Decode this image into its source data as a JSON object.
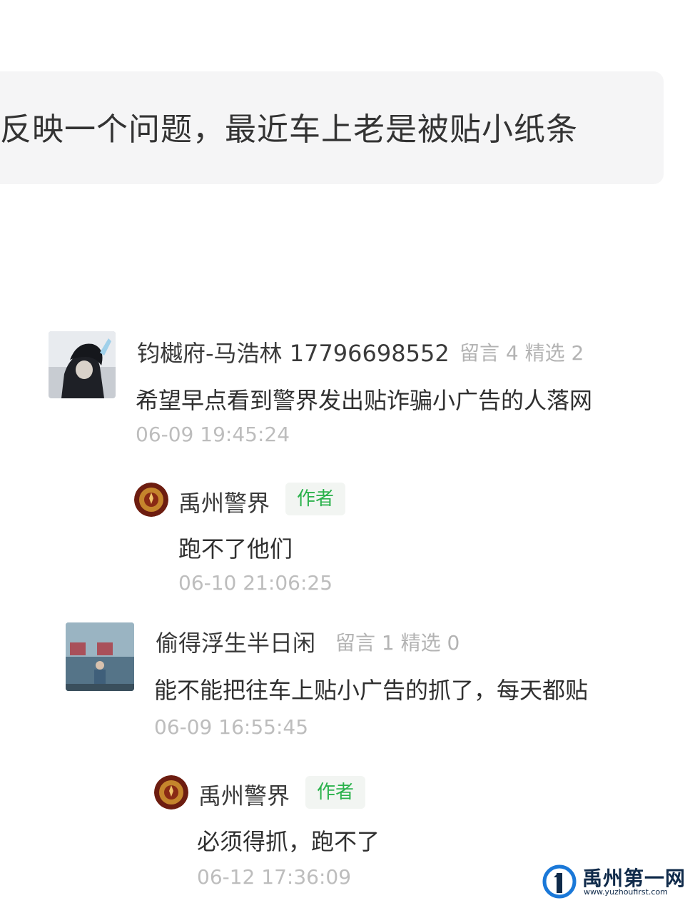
{
  "post": {
    "quote_text": "反映一个问题，最近车上老是被贴小纸条"
  },
  "comments": [
    {
      "author": "钧樾府-马浩林 17796698552",
      "stats": "留言 4 精选 2",
      "text": "希望早点看到警界发出贴诈骗小广告的人落网",
      "time": "06-09 19:45:24",
      "reply": {
        "author": "禹州警界",
        "badge": "作者",
        "text": "跑不了他们",
        "time": "06-10 21:06:25"
      }
    },
    {
      "author": "偷得浮生半日闲",
      "stats": "留言 1 精选 0",
      "text": "能不能把往车上贴小广告的抓了，每天都贴",
      "time": "06-09 16:55:45",
      "reply": {
        "author": "禹州警界",
        "badge": "作者",
        "text": "必须得抓，跑不了",
        "time": "06-12 17:36:09"
      }
    }
  ],
  "watermark": {
    "brand": "禹州第一网",
    "url": "www.yuzhoufirst.com"
  },
  "colors": {
    "author_badge": "#2bb24c",
    "timestamp": "#bdbdbd",
    "quote_background": "#f5f5f6"
  },
  "icons": [
    "user-avatar",
    "author-avatar",
    "brand-logo-icon"
  ]
}
